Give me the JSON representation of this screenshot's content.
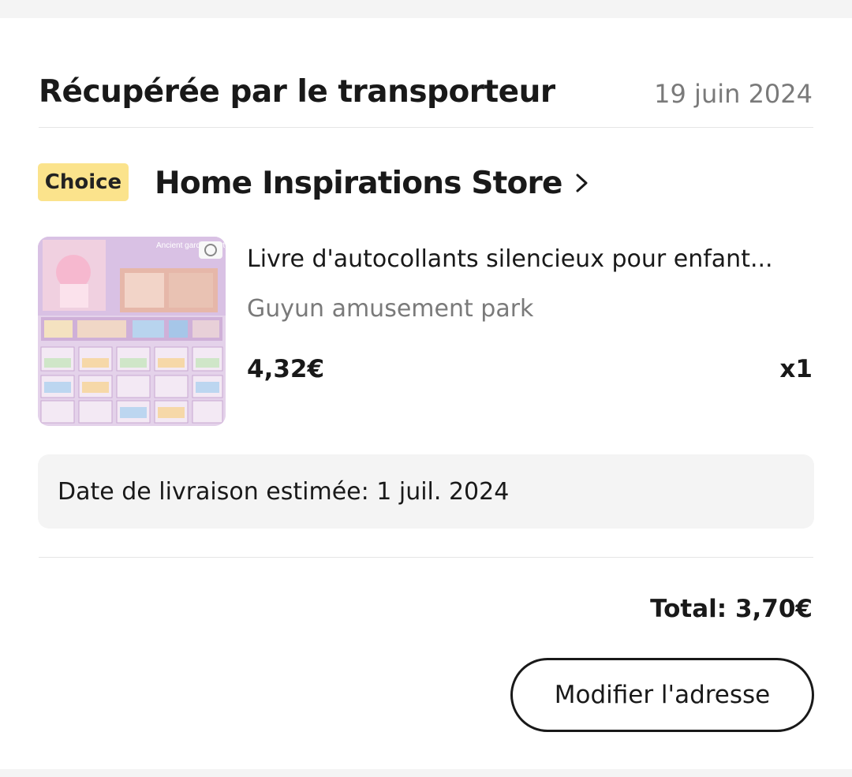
{
  "order": {
    "status_title": "Récupérée par le transporteur",
    "status_date": "19 juin 2024"
  },
  "store": {
    "badge": "Choice",
    "name": "Home Inspirations Store",
    "chevron_icon": "chevron-right-icon",
    "badge_color": "#fbe38c"
  },
  "product": {
    "image_text": "Ancient garden party",
    "title": "Livre d'autocollants silencieux pour enfant...",
    "variant": "Guyun amusement park",
    "price": "4,32€",
    "quantity": "x1"
  },
  "delivery": {
    "estimate": "Date de livraison estimée: 1 juil. 2024"
  },
  "summary": {
    "total": "Total: 3,70€"
  },
  "actions": {
    "modify_address": "Modifier l'adresse"
  }
}
